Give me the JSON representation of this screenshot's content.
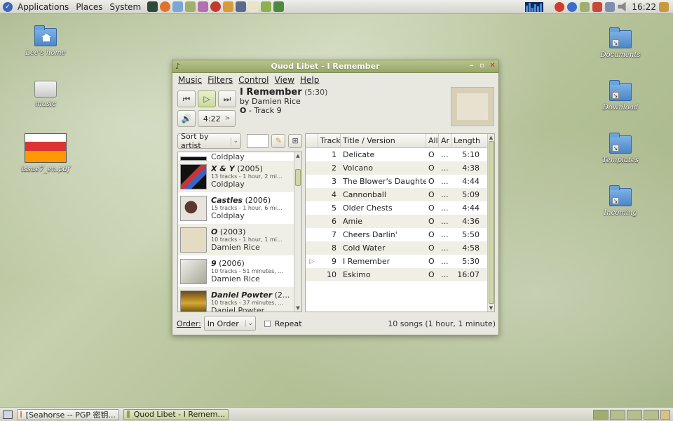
{
  "top_panel": {
    "menus": [
      "Applications",
      "Places",
      "System"
    ],
    "clock": "16:22"
  },
  "desktop": {
    "left_icons": [
      {
        "label": "Lee's home"
      },
      {
        "label": "music"
      },
      {
        "label": "issue7_en.pdf"
      }
    ],
    "right_icons": [
      {
        "label": "Documents"
      },
      {
        "label": "Download"
      },
      {
        "label": "Templates"
      },
      {
        "label": "Incoming"
      }
    ]
  },
  "window": {
    "title": "Quod Libet - I Remember",
    "menu": [
      "Music",
      "Filters",
      "Control",
      "View",
      "Help"
    ],
    "now_playing": {
      "song": "I Remember",
      "duration": "(5:30)",
      "by_line": "by Damien Rice",
      "album": "O",
      "track_suffix": "- Track 9",
      "time": "4:22",
      "time_arrow": ">"
    },
    "sort_label": "Sort by artist",
    "albums": [
      {
        "name": "",
        "year": "",
        "info": "",
        "artist": "Coldplay"
      },
      {
        "name": "X & Y",
        "year": "(2005)",
        "info": "13 tracks - 1 hour, 2 mi...",
        "artist": "Coldplay"
      },
      {
        "name": "Castles",
        "year": "(2006)",
        "info": "15 tracks - 1 hour, 6 mi...",
        "artist": "Coldplay"
      },
      {
        "name": "O",
        "year": "(2003)",
        "info": "10 tracks - 1 hour, 1 mi...",
        "artist": "Damien Rice"
      },
      {
        "name": "9",
        "year": "(2006)",
        "info": "10 tracks - 51 minutes, ...",
        "artist": "Damien Rice"
      },
      {
        "name": "Daniel Powter",
        "year": "(2...",
        "info": "10 tracks - 37 minutes, ...",
        "artist": "Daniel Powter"
      }
    ],
    "song_columns": [
      "Track",
      "Title / Version",
      "All",
      "Ar",
      "Length"
    ],
    "songs": [
      {
        "track": "1",
        "title": "Delicate",
        "all": "O",
        "ar": "...",
        "length": "5:10"
      },
      {
        "track": "2",
        "title": "Volcano",
        "all": "O",
        "ar": "...",
        "length": "4:38"
      },
      {
        "track": "3",
        "title": "The Blower's Daughter",
        "all": "O",
        "ar": "...",
        "length": "4:44"
      },
      {
        "track": "4",
        "title": "Cannonball",
        "all": "O",
        "ar": "...",
        "length": "5:09"
      },
      {
        "track": "5",
        "title": "Older Chests",
        "all": "O",
        "ar": "...",
        "length": "4:44"
      },
      {
        "track": "6",
        "title": "Amie",
        "all": "O",
        "ar": "...",
        "length": "4:36"
      },
      {
        "track": "7",
        "title": "Cheers Darlin'",
        "all": "O",
        "ar": "...",
        "length": "5:50"
      },
      {
        "track": "8",
        "title": "Cold Water",
        "all": "O",
        "ar": "...",
        "length": "4:58"
      },
      {
        "track": "9",
        "title": "I Remember",
        "all": "O",
        "ar": "...",
        "length": "5:30"
      },
      {
        "track": "10",
        "title": "Eskimo",
        "all": "O",
        "ar": "...",
        "length": "16:07"
      }
    ],
    "playing_index": 8,
    "order_label": "Order:",
    "order_value": "In Order",
    "repeat_label": "Repeat",
    "status": "10 songs (1 hour, 1 minute)"
  },
  "taskbar": {
    "tasks": [
      {
        "label": "[Seahorse -- PGP 密钥..."
      },
      {
        "label": "Quod Libet - I Remem..."
      }
    ]
  },
  "colors": {
    "titlebar": "#a7b37a",
    "accent": "#cbd99c",
    "desktop": "#b4c197"
  }
}
